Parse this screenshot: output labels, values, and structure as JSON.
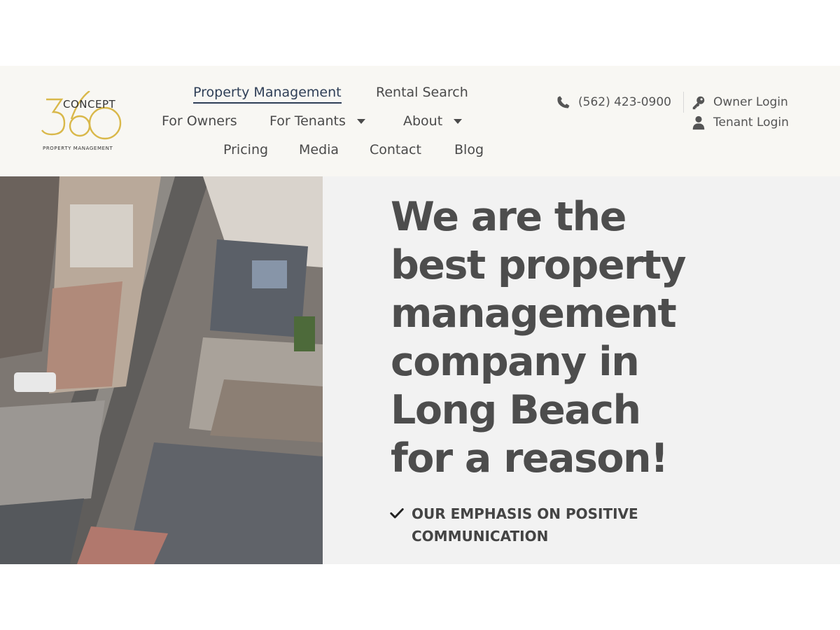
{
  "logo": {
    "number": "360",
    "word": "CONCEPT",
    "tagline": "PROPERTY MANAGEMENT"
  },
  "nav": {
    "property_management": "Property Management",
    "rental_search": "Rental Search",
    "for_owners": "For Owners",
    "for_tenants": "For Tenants",
    "about": "About",
    "pricing": "Pricing",
    "media": "Media",
    "contact": "Contact",
    "blog": "Blog"
  },
  "contact": {
    "phone": "(562) 423-0900",
    "owner_login": "Owner Login",
    "tenant_login": "Tenant Login"
  },
  "hero": {
    "headline_lines": [
      "We are the",
      "best property",
      "management",
      "company in",
      "Long Beach",
      "for a reason!"
    ],
    "bullet": "OUR EMPHASIS ON POSITIVE COMMUNICATION"
  },
  "colors": {
    "header_bg": "#f8f7f3",
    "hero_bg": "#f2f2f2",
    "logo_gold": "#d9b84a",
    "active_nav": "#2f3f57",
    "text": "#4d4d4d"
  },
  "icons": [
    "phone-icon",
    "key-icon",
    "user-icon",
    "check-icon",
    "chevron-down-icon"
  ]
}
